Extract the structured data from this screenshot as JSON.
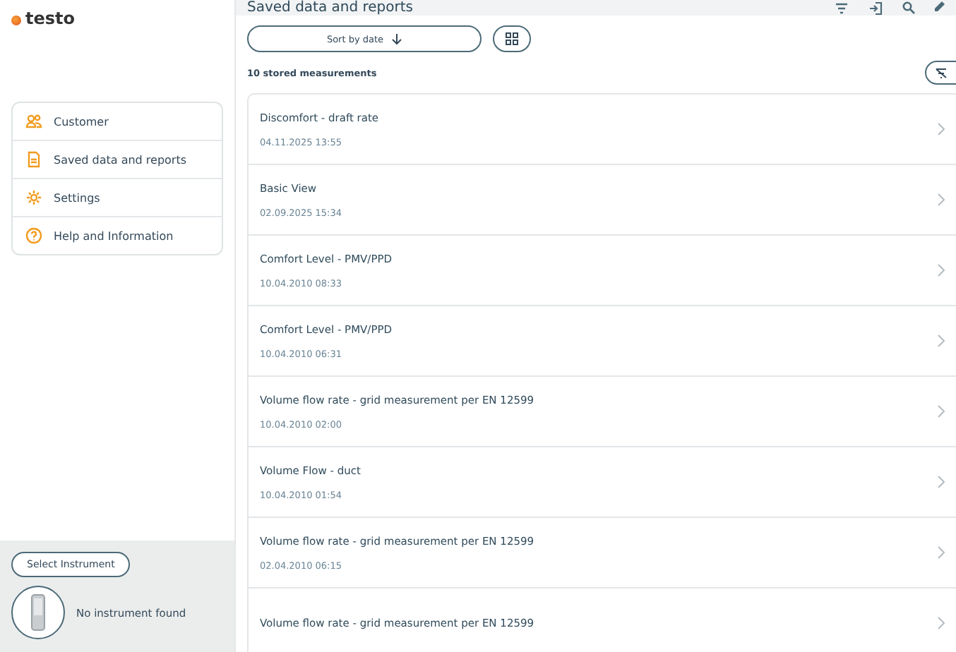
{
  "logo": {
    "text": "testo"
  },
  "menu": [
    {
      "label": "Customer",
      "kind": "people"
    },
    {
      "label": "Saved data and reports",
      "kind": "document"
    },
    {
      "label": "Settings",
      "kind": "gear"
    },
    {
      "label": "Help and Information",
      "kind": "help"
    }
  ],
  "instrument": {
    "button": "Select Instrument",
    "status": "No instrument found"
  },
  "header": {
    "title": "Saved data and reports"
  },
  "sort": {
    "label": "Sort by date"
  },
  "count": "10 stored measurements",
  "measurements": [
    {
      "title": "Discomfort - draft rate",
      "date": "04.11.2025 13:55"
    },
    {
      "title": "Basic View",
      "date": "02.09.2025 15:34"
    },
    {
      "title": "Comfort Level - PMV/PPD",
      "date": "10.04.2010 08:33"
    },
    {
      "title": "Comfort Level - PMV/PPD",
      "date": "10.04.2010 06:31"
    },
    {
      "title": "Volume flow rate - grid measurement per EN 12599",
      "date": "10.04.2010 02:00"
    },
    {
      "title": "Volume Flow - duct",
      "date": "10.04.2010 01:54"
    },
    {
      "title": "Volume flow rate - grid measurement per EN 12599",
      "date": "02.04.2010 06:15"
    },
    {
      "title": "Volume flow rate - grid measurement per EN 12599"
    }
  ]
}
